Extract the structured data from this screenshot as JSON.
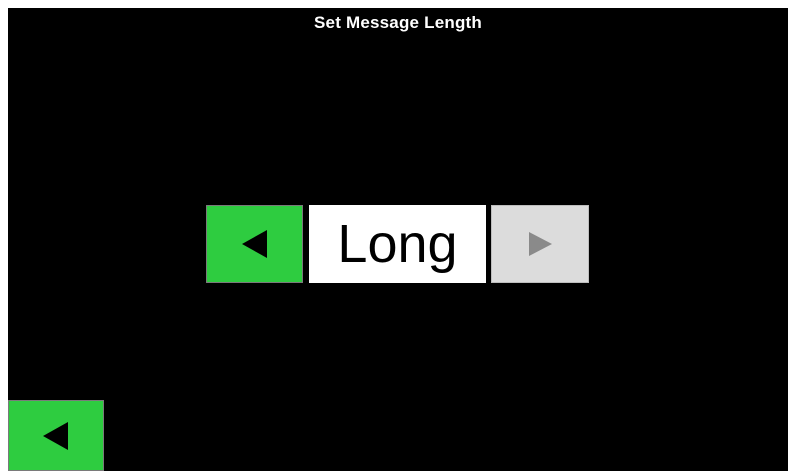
{
  "screen": {
    "title": "Set Message Length",
    "background_color": "#000000"
  },
  "selector": {
    "value": "Long",
    "prev_button": {
      "icon": "left-triangle-icon",
      "color": "#2ecc40",
      "enabled": true
    },
    "next_button": {
      "icon": "right-triangle-icon",
      "color": "#dcdcdc",
      "enabled": false
    }
  },
  "navigation": {
    "back_button": {
      "icon": "left-triangle-icon",
      "color": "#2ecc40"
    }
  }
}
